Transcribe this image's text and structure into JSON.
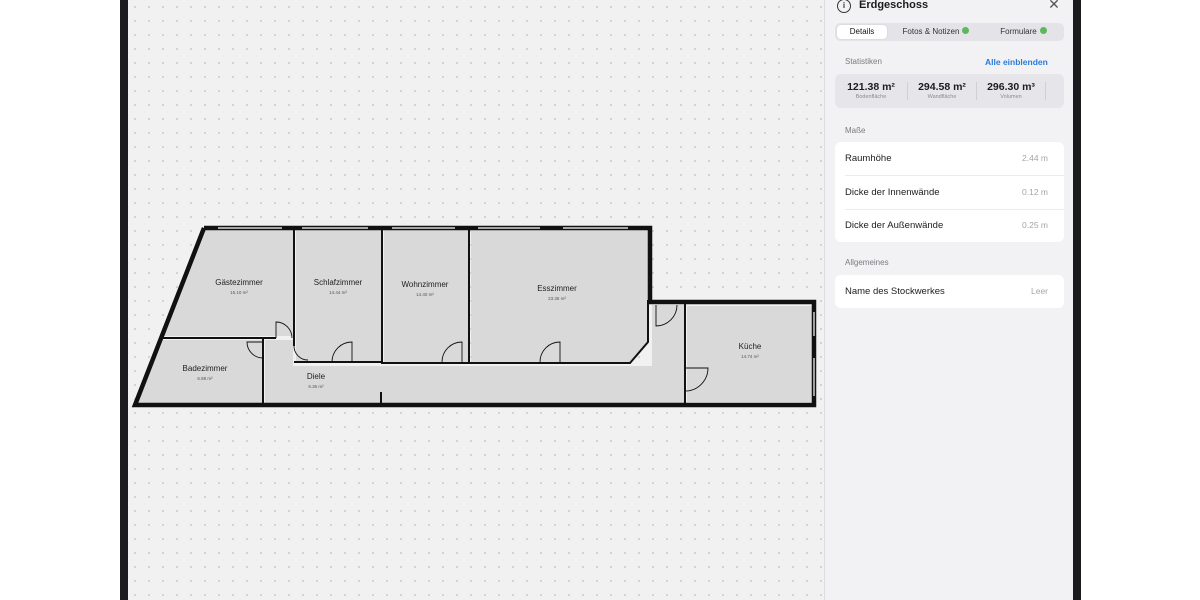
{
  "panel": {
    "title": "Erdgeschoss",
    "tabs": [
      {
        "label": "Details",
        "active": true,
        "badge": false
      },
      {
        "label": "Fotos & Notizen",
        "active": false,
        "badge": true
      },
      {
        "label": "Formulare",
        "active": false,
        "badge": true
      }
    ],
    "statistics": {
      "heading": "Statistiken",
      "show_all": "Alle einblenden",
      "items": [
        {
          "value": "121.38 m²",
          "label": "Bodenfläche"
        },
        {
          "value": "294.58 m²",
          "label": "Wandfläche"
        },
        {
          "value": "296.30 m³",
          "label": "Volumen"
        }
      ]
    },
    "measures": {
      "heading": "Maße",
      "rows": [
        {
          "label": "Raumhöhe",
          "value": "2.44 m"
        },
        {
          "label": "Dicke der Innenwände",
          "value": "0.12 m"
        },
        {
          "label": "Dicke der Außenwände",
          "value": "0.25 m"
        }
      ]
    },
    "general": {
      "heading": "Allgemeines",
      "rows": [
        {
          "label": "Name des Stockwerkes",
          "value": "Leer"
        }
      ]
    }
  },
  "floorplan": {
    "rooms": [
      {
        "name": "Gästezimmer",
        "area": "15.10 m²"
      },
      {
        "name": "Schlafzimmer",
        "area": "14.44 m²"
      },
      {
        "name": "Wohnzimmer",
        "area": "14.40 m²"
      },
      {
        "name": "Esszimmer",
        "area": "23.36 m²"
      },
      {
        "name": "Badezimmer",
        "area": "6.88 m²"
      },
      {
        "name": "Diele",
        "area": "6.36 m²"
      },
      {
        "name": "Küche",
        "area": "14.74 m²"
      }
    ]
  },
  "colors": {
    "accent": "#2a7ad8",
    "badge": "#5cb85c",
    "wall": "#111111",
    "room_fill": "#d9d9d9"
  }
}
